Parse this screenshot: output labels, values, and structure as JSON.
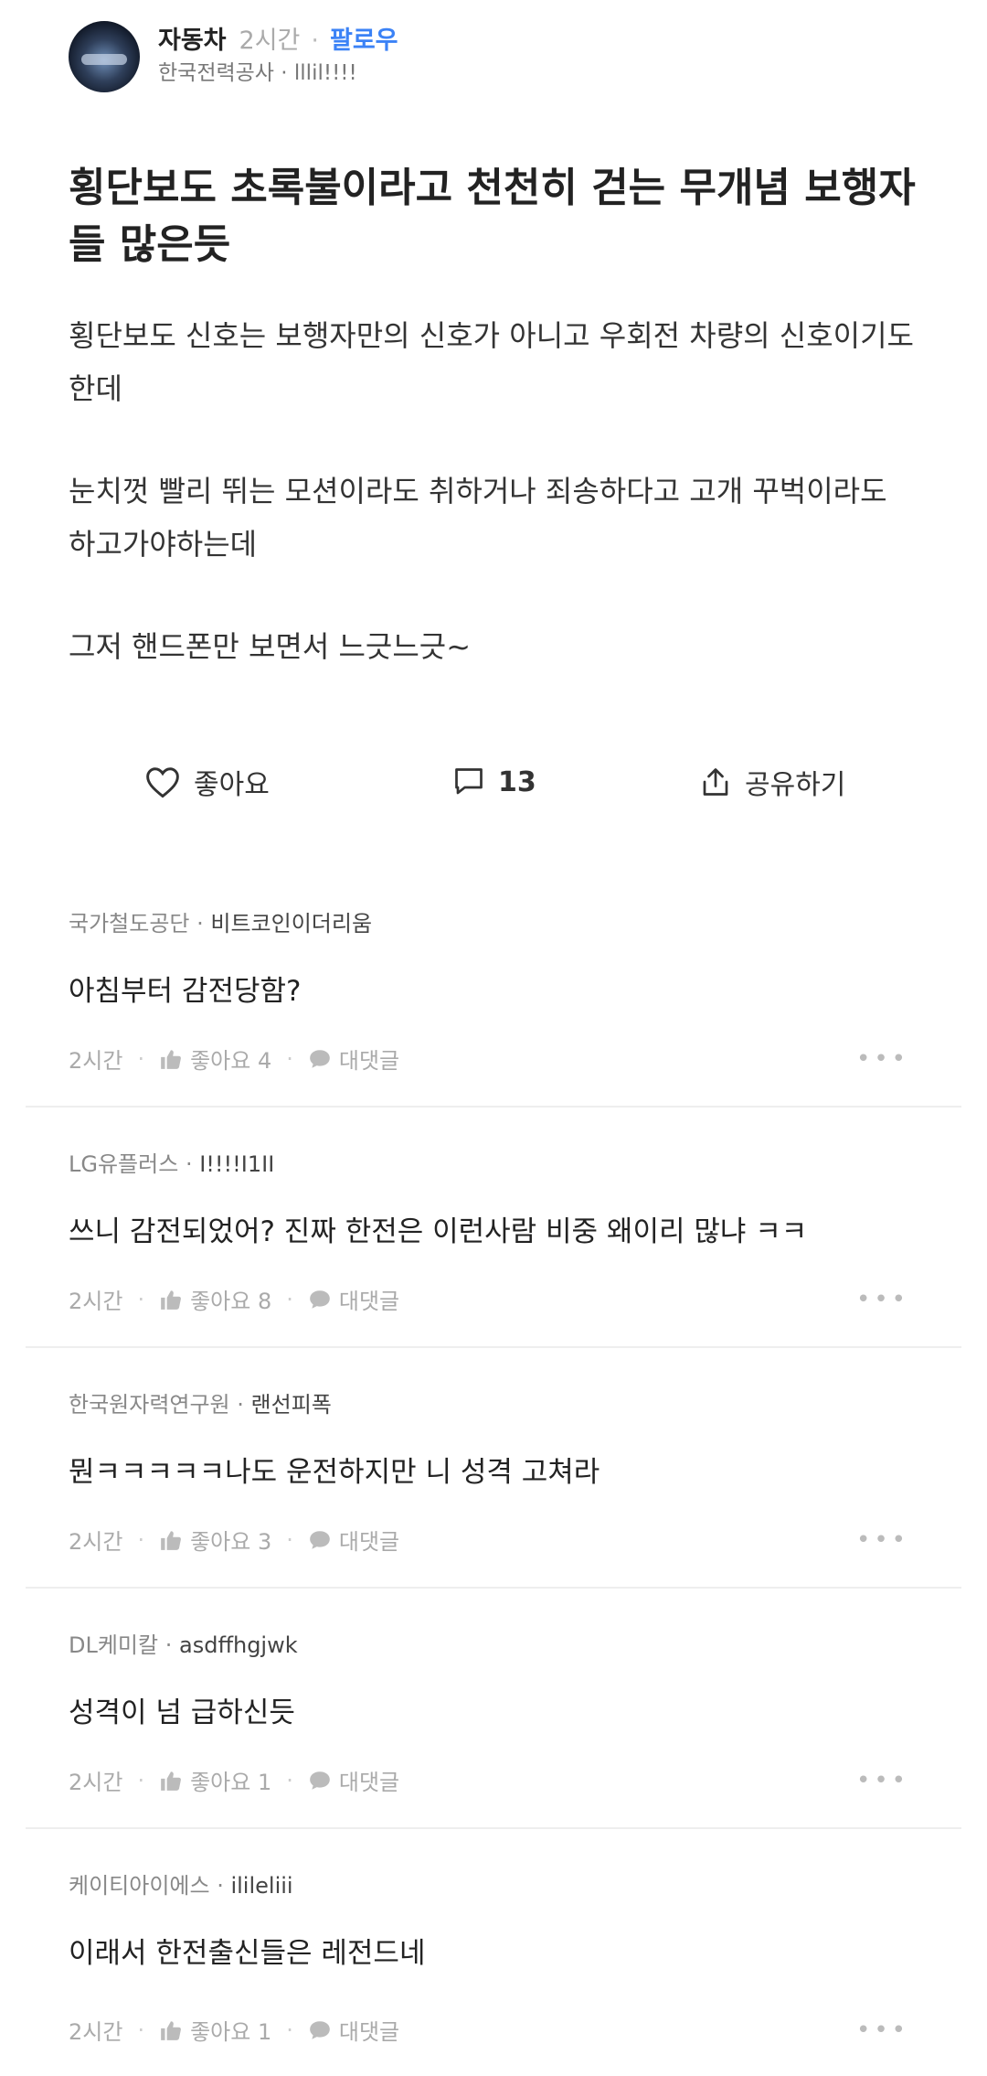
{
  "post": {
    "author": "자동차",
    "time": "2시간",
    "follow_label": "팔로우",
    "company": "한국전력공사",
    "nickname": "lllil!!!!",
    "title": "횡단보도 초록불이라고 천천히 걷는 무개념 보행자들 많은듯",
    "body": [
      "횡단보도 신호는 보행자만의 신호가 아니고 우회전 차량의 신호이기도 한데",
      "눈치껏 빨리 뛰는 모션이라도 취하거나 죄송하다고 고개 꾸벅이라도 하고가야하는데",
      "그저 핸드폰만 보면서 느긋느긋~"
    ],
    "like_label": "좋아요",
    "comment_count": "13",
    "share_label": "공유하기"
  },
  "comments": [
    {
      "company": "국가철도공단",
      "nick": "비트코인이더리움",
      "text": "아침부터 감전당함?",
      "time": "2시간",
      "likes": "좋아요 4",
      "reply": "대댓글"
    },
    {
      "company": "LG유플러스",
      "nick": "I!!!!I1II",
      "text": "쓰니 감전되었어? 진짜 한전은 이런사람 비중 왜이리 많냐 ㅋㅋ",
      "time": "2시간",
      "likes": "좋아요 8",
      "reply": "대댓글"
    },
    {
      "company": "한국원자력연구원",
      "nick": "랜선피폭",
      "text": "뭔ㅋㅋㅋㅋㅋ나도 운전하지만 니 성격 고쳐라",
      "time": "2시간",
      "likes": "좋아요 3",
      "reply": "대댓글"
    },
    {
      "company": "DL케미칼",
      "nick": "asdffhgjwk",
      "text": "성격이 넘 급하신듯",
      "time": "2시간",
      "likes": "좋아요 1",
      "reply": "대댓글"
    },
    {
      "company": "케이티아이에스",
      "nick": "ilileliii",
      "text": "이래서 한전출신들은 레전드네",
      "time": "2시간",
      "likes": "좋아요 1",
      "reply": "대댓글"
    }
  ]
}
